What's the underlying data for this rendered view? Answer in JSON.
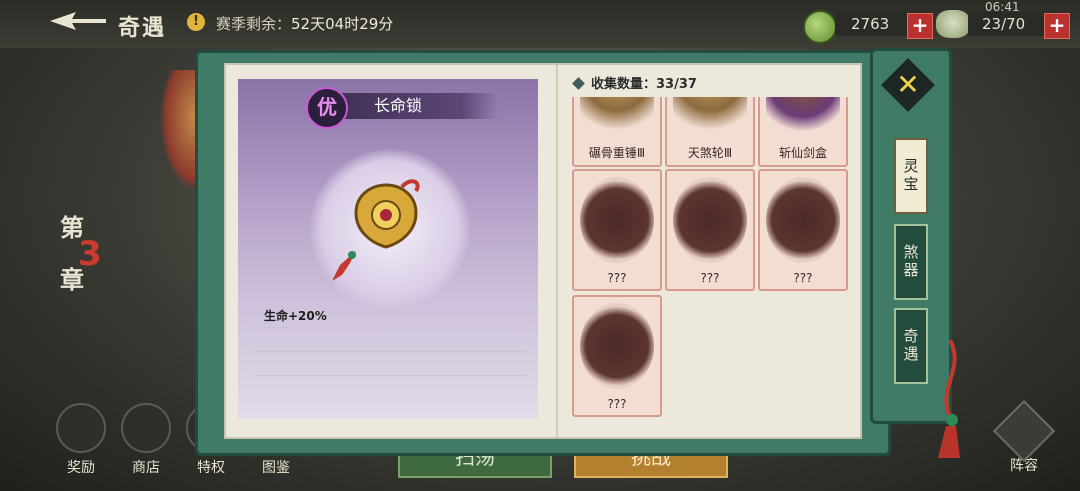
{
  "status": {
    "time": "06:41"
  },
  "header": {
    "title": "奇遇",
    "season_label": "赛季剩余：",
    "season_remaining": "52天04时29分",
    "coins": "2763",
    "stamina": "23/70"
  },
  "side": {
    "chapter_top": "第",
    "chapter_num": "3",
    "chapter_bottom": "章"
  },
  "bottom_nav": [
    {
      "label": "奖励"
    },
    {
      "label": "商店"
    },
    {
      "label": "特权"
    },
    {
      "label": "图鉴"
    }
  ],
  "lineup_label": "阵容",
  "actions": {
    "sweep": "扫荡",
    "challenge": "挑战"
  },
  "detail": {
    "quality": "优",
    "name": "长命锁",
    "stat": "生命+20%"
  },
  "collection": {
    "label": "收集数量：",
    "count": "33/37",
    "items": [
      {
        "name": "碾骨重锤Ⅲ"
      },
      {
        "name": "天煞轮Ⅲ"
      },
      {
        "name": "斩仙剑盒"
      },
      {
        "name": "???"
      },
      {
        "name": "???"
      },
      {
        "name": "???"
      },
      {
        "name": "???"
      }
    ]
  },
  "tabs": [
    {
      "label": "灵宝"
    },
    {
      "label": "煞器"
    },
    {
      "label": "奇遇"
    }
  ],
  "colors": {
    "book_green": "#3f7b66",
    "accent_red": "#b93230",
    "quality_purple": "#c95ad2"
  }
}
